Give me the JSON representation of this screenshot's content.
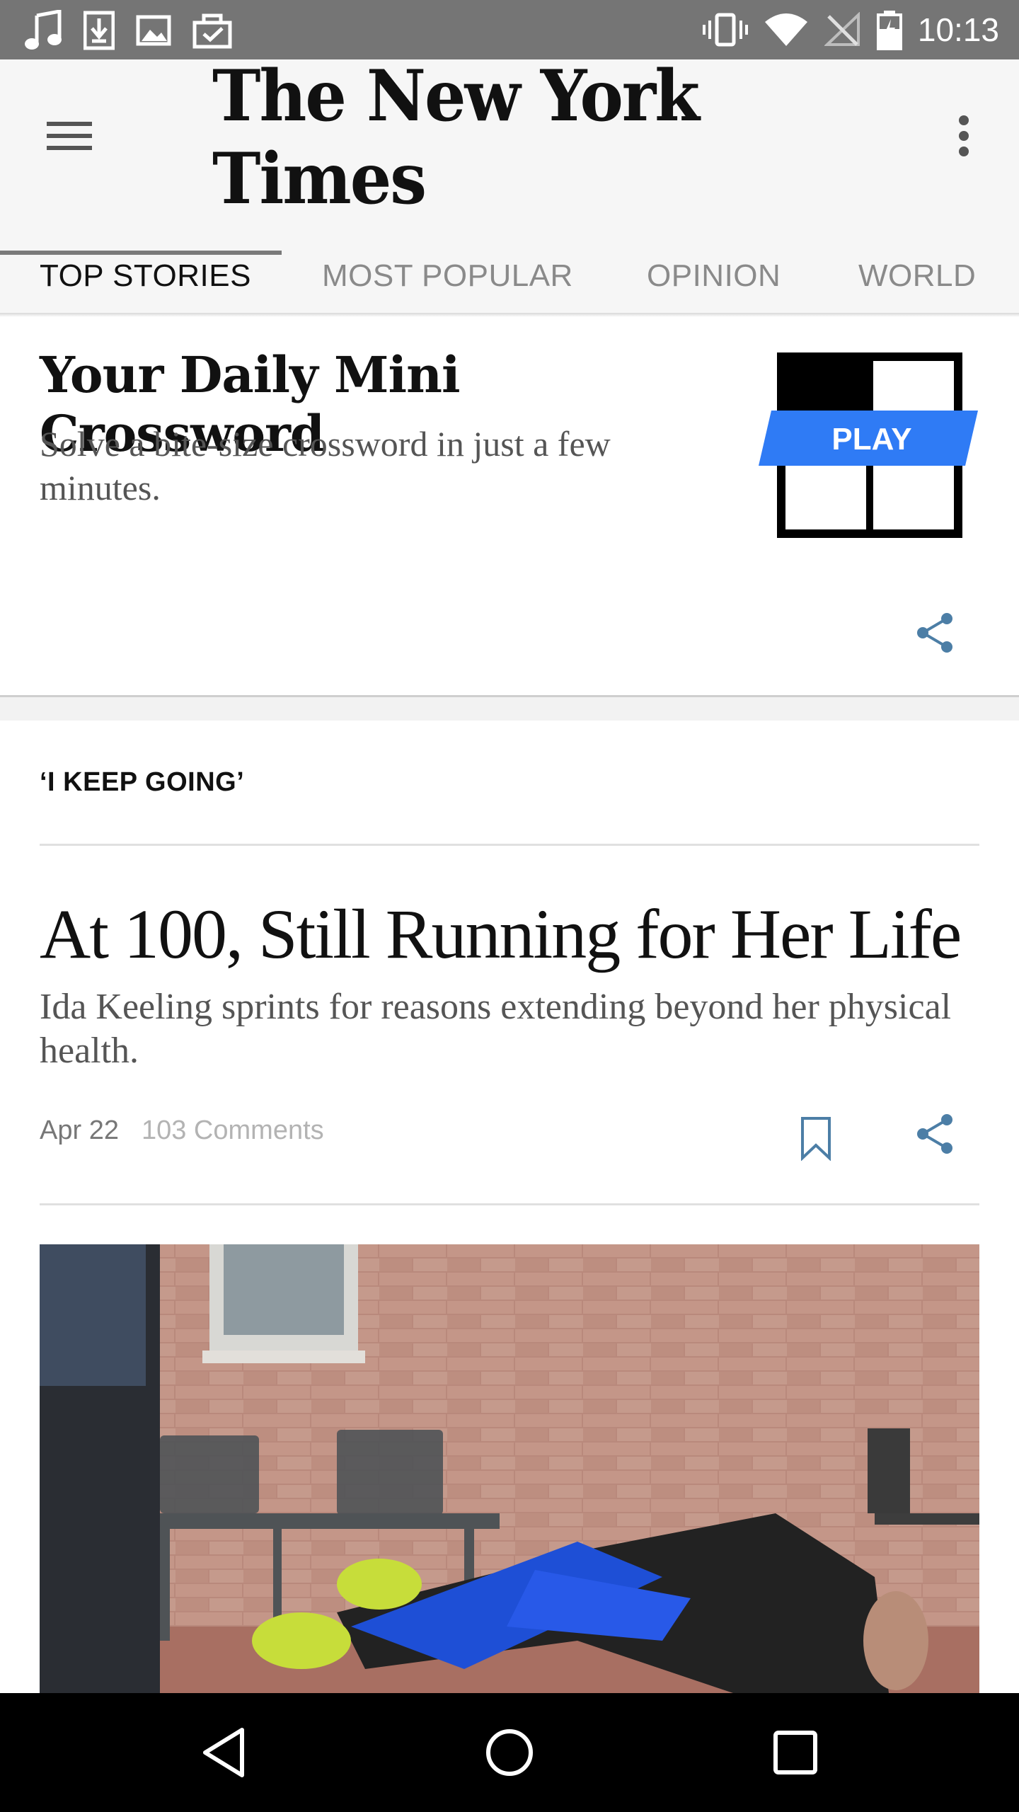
{
  "status_bar": {
    "time": "10:13",
    "left_icons": [
      "music-note-icon",
      "download-icon",
      "image-icon",
      "clipboard-check-icon"
    ],
    "right_icons": [
      "vibrate-icon",
      "wifi-icon",
      "no-signal-icon",
      "battery-icon"
    ]
  },
  "app_bar": {
    "title": "The New York Times",
    "menu_icon": "hamburger-menu-icon",
    "overflow_icon": "more-vert-icon"
  },
  "tabs": [
    {
      "label": "TOP STORIES",
      "active": true
    },
    {
      "label": "MOST POPULAR",
      "active": false
    },
    {
      "label": "OPINION",
      "active": false
    },
    {
      "label": "WORLD",
      "active": false
    }
  ],
  "crossword_card": {
    "title": "Your Daily Mini Crossword",
    "subtitle": "Solve a bite-size crossword in just a few minutes.",
    "play_label": "PLAY",
    "accent_color": "#2f7bf5"
  },
  "article": {
    "kicker": "‘I KEEP GOING’",
    "headline": "At 100, Still Running for Her Life",
    "summary": "Ida Keeling sprints for reasons extending beyond her physical health.",
    "date": "Apr 22",
    "comments": "103 Comments"
  },
  "nav_bar": {
    "icons": [
      "back-icon",
      "home-icon",
      "recent-apps-icon"
    ]
  }
}
